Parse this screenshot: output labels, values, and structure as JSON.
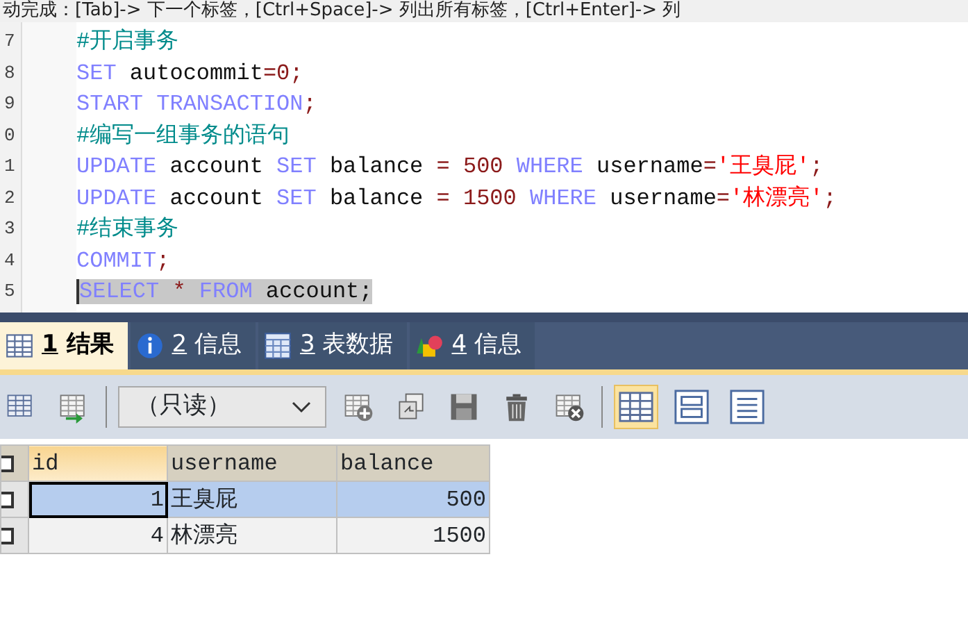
{
  "hint_bar": {
    "text": "动完成：[Tab]-> 下一个标签，[Ctrl+Space]-> 列出所有标签，[Ctrl+Enter]-> 列"
  },
  "editor": {
    "lines": [
      {
        "number": "7",
        "selected": false,
        "tokens": [
          {
            "kind": "comment",
            "text": "#开启事务"
          }
        ]
      },
      {
        "number": "8",
        "selected": false,
        "tokens": [
          {
            "kind": "keyword",
            "text": "SET"
          },
          {
            "kind": "plain",
            "text": " autocommit"
          },
          {
            "kind": "op",
            "text": "=0;"
          }
        ]
      },
      {
        "number": "9",
        "selected": false,
        "tokens": [
          {
            "kind": "keyword",
            "text": "START TRANSACTION"
          },
          {
            "kind": "op",
            "text": ";"
          }
        ]
      },
      {
        "number": "0",
        "selected": false,
        "tokens": [
          {
            "kind": "comment",
            "text": "#编写一组事务的语句"
          }
        ]
      },
      {
        "number": "1",
        "selected": false,
        "tokens": [
          {
            "kind": "keyword",
            "text": "UPDATE"
          },
          {
            "kind": "plain",
            "text": " account "
          },
          {
            "kind": "keyword",
            "text": "SET"
          },
          {
            "kind": "plain",
            "text": " balance "
          },
          {
            "kind": "op",
            "text": "= 500 "
          },
          {
            "kind": "keyword",
            "text": "WHERE"
          },
          {
            "kind": "plain",
            "text": " username"
          },
          {
            "kind": "op",
            "text": "="
          },
          {
            "kind": "string",
            "text": "'王臭屁'"
          },
          {
            "kind": "op",
            "text": ";"
          }
        ]
      },
      {
        "number": "2",
        "selected": false,
        "tokens": [
          {
            "kind": "keyword",
            "text": "UPDATE"
          },
          {
            "kind": "plain",
            "text": " account "
          },
          {
            "kind": "keyword",
            "text": "SET"
          },
          {
            "kind": "plain",
            "text": " balance "
          },
          {
            "kind": "op",
            "text": "= 1500 "
          },
          {
            "kind": "keyword",
            "text": "WHERE"
          },
          {
            "kind": "plain",
            "text": " username"
          },
          {
            "kind": "op",
            "text": "="
          },
          {
            "kind": "string",
            "text": "'林漂亮'"
          },
          {
            "kind": "op",
            "text": ";"
          }
        ]
      },
      {
        "number": "3",
        "selected": false,
        "tokens": [
          {
            "kind": "comment",
            "text": "#结束事务"
          }
        ]
      },
      {
        "number": "4",
        "selected": false,
        "tokens": [
          {
            "kind": "keyword",
            "text": "COMMIT"
          },
          {
            "kind": "op",
            "text": ";"
          }
        ]
      },
      {
        "number": "5",
        "selected": true,
        "tokens": [
          {
            "kind": "keyword",
            "text": "SELECT"
          },
          {
            "kind": "op",
            "text": " * "
          },
          {
            "kind": "keyword",
            "text": "FROM"
          },
          {
            "kind": "plain",
            "text": " account;"
          }
        ]
      }
    ]
  },
  "result_tabs": [
    {
      "number": "1",
      "label": "结果",
      "selected": true
    },
    {
      "number": "2",
      "label": "信息",
      "selected": false
    },
    {
      "number": "3",
      "label": "表数据",
      "selected": false
    },
    {
      "number": "4",
      "label": "信息",
      "selected": false
    }
  ],
  "toolbar": {
    "mode_select": {
      "value": "（只读）"
    },
    "layout_buttons": [
      {
        "selected": true
      },
      {
        "selected": false
      },
      {
        "selected": false
      }
    ]
  },
  "table": {
    "columns": [
      "id",
      "username",
      "balance"
    ],
    "all_checked": false,
    "rows": [
      {
        "cells": [
          "1",
          "王臭屁",
          "500"
        ],
        "selected": true,
        "checked": false
      },
      {
        "cells": [
          "4",
          "林漂亮",
          "1500"
        ],
        "selected": false,
        "checked": false
      }
    ]
  }
}
